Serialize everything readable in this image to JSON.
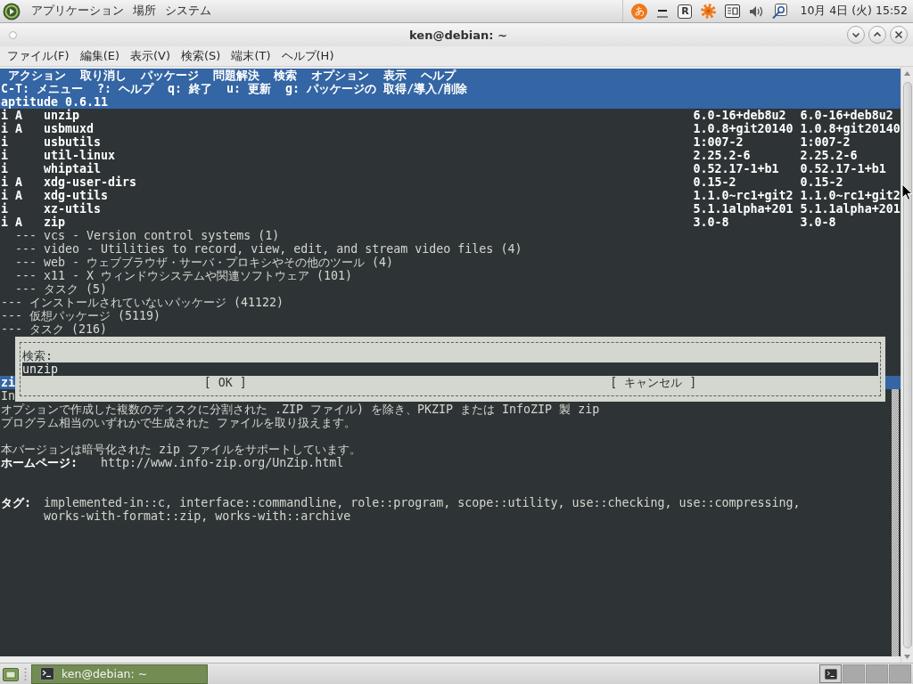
{
  "top_panel": {
    "menus": [
      "アプリケーション",
      "場所",
      "システム"
    ],
    "input_method": "あ",
    "indicator": "R",
    "clock": "10月 4日 (火) 15:52"
  },
  "window": {
    "title": "ken@debian: ~",
    "menu_bar": [
      "ファイル(F)",
      "編集(E)",
      "表示(V)",
      "検索(S)",
      "端末(T)",
      "ヘルプ(H)"
    ]
  },
  "aptitude": {
    "menu": [
      "アクション",
      "取り消し",
      "パッケージ",
      "問題解決",
      "検索",
      "オプション",
      "表示",
      "ヘルプ"
    ],
    "shortcuts": "C-T: メニュー  ?: ヘルプ  q: 終了  u: 更新  g: パッケージの 取得/導入/削除",
    "version": "aptitude 0.6.11",
    "tree": [
      {
        "kind": "group",
        "children": [
          {
            "kind": "group",
            "children": [
              {
                "kind": "package",
                "column_1": "i",
                "column_2": "A",
                "name": "unzip",
                "column_4": "6.0-16+deb8u2",
                "column_5": "6.0-16+deb8u2"
              },
              {
                "kind": "package",
                "column_1": "i",
                "column_2": "A",
                "name": "usbmuxd",
                "column_4": "1.0.8+git20140",
                "column_5": "1.0.8+git20140"
              },
              {
                "kind": "package",
                "column_1": "i",
                "name": "usbutils",
                "column_4": "1:007-2",
                "column_5": "1:007-2"
              },
              {
                "kind": "package",
                "column_1": "i",
                "name": "util-linux",
                "column_4": "2.25.2-6",
                "column_5": "2.25.2-6"
              },
              {
                "kind": "package",
                "column_1": "i",
                "name": "whiptail",
                "column_4": "0.52.17-1+b1",
                "column_5": "0.52.17-1+b1"
              },
              {
                "kind": "package",
                "column_1": "i",
                "column_2": "A",
                "name": "xdg-user-dirs",
                "column_4": "0.15-2",
                "column_5": "0.15-2"
              },
              {
                "kind": "package",
                "column_1": "i",
                "column_2": "A",
                "name": "xdg-utils",
                "column_4": "1.1.0~rc1+git2",
                "column_5": "1.1.0~rc1+git2"
              },
              {
                "kind": "package",
                "column_1": "i",
                "name": "xz-utils",
                "column_4": "5.1.1alpha+201",
                "column_5": "5.1.1alpha+201"
              },
              {
                "kind": "package",
                "column_1": "i",
                "column_2": "A",
                "name": "zip",
                "column_4": "3.0-8",
                "column_5": "3.0-8"
              }
            ]
          },
          {
            "kind": "group",
            "marker": "---",
            "label": "vcs - Version control systems (1)"
          },
          {
            "kind": "group",
            "marker": "---",
            "label": "video - Utilities to record, view, edit, and stream video files (4)"
          },
          {
            "kind": "group",
            "marker": "---",
            "label": "web - ウェブブラウザ・サーバ・プロキシやその他のツール (4)"
          },
          {
            "kind": "group",
            "marker": "---",
            "label": "x11 - X ウィンドウシステムや関連ソフトウェア (101)"
          },
          {
            "kind": "group",
            "marker": "---",
            "label": "タスク (5)"
          }
        ]
      },
      {
        "kind": "group",
        "marker": "---",
        "label": "インストールされていないパッケージ (41122)"
      },
      {
        "kind": "group",
        "marker": "---",
        "label": "仮想パッケージ (5119)"
      },
      {
        "kind": "group",
        "marker": "---",
        "label": "タスク (216)"
      }
    ],
    "description_title": "zi",
    "description": {
      "paragraphs": [
        [
          "In",
          "オプションで作成した複数のディスクに分割された .ZIP ファイル) を除き、PKZIP または InfoZIP 製 zip",
          "プログラム相当のいずれかで生成された ファイルを取り扱えます。"
        ],
        [
          "本バージョンは暗号化された zip ファイルをサポートしています。"
        ]
      ],
      "homepage": {
        "label": "ホームページ:",
        "url": "http://www.info-zip.org/UnZip.html"
      },
      "tags": {
        "label": "タグ:",
        "lines": [
          "implemented-in::c, interface::commandline, role::program, scope::utility, use::checking, use::compressing,",
          "works-with-format::zip, works-with::archive"
        ]
      }
    },
    "search_dialog": {
      "label": "検索:",
      "value": "unzip",
      "buttons": [
        "[ OK ]",
        "[ キャンセル ]"
      ]
    }
  },
  "taskbar": {
    "tasks": [
      {
        "label": "ken@debian: ~",
        "selected": true
      }
    ],
    "workspaces": [
      {
        "selected": true,
        "has_window": true
      },
      {
        "selected": false,
        "has_window": false
      },
      {
        "selected": false,
        "has_window": false
      },
      {
        "selected": false,
        "has_window": false
      }
    ]
  }
}
